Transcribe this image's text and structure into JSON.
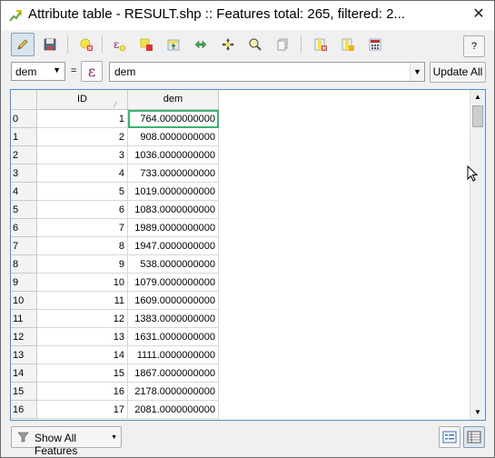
{
  "window": {
    "title": "Attribute table - RESULT.shp :: Features total: 265, filtered: 2...",
    "close_label": "✕"
  },
  "toolbar": {
    "help_label": "?"
  },
  "filter": {
    "field_value": "dem",
    "equals": "=",
    "expression_symbol": "ε",
    "expression_value": "dem",
    "update_label": "Update All"
  },
  "table": {
    "columns": [
      "ID",
      "dem"
    ],
    "rows": [
      {
        "row": "0",
        "id": "1",
        "dem": "764.0000000000"
      },
      {
        "row": "1",
        "id": "2",
        "dem": "908.0000000000"
      },
      {
        "row": "2",
        "id": "3",
        "dem": "1036.0000000000"
      },
      {
        "row": "3",
        "id": "4",
        "dem": "733.0000000000"
      },
      {
        "row": "4",
        "id": "5",
        "dem": "1019.0000000000"
      },
      {
        "row": "5",
        "id": "6",
        "dem": "1083.0000000000"
      },
      {
        "row": "6",
        "id": "7",
        "dem": "1989.0000000000"
      },
      {
        "row": "7",
        "id": "8",
        "dem": "1947.0000000000"
      },
      {
        "row": "8",
        "id": "9",
        "dem": "538.0000000000"
      },
      {
        "row": "9",
        "id": "10",
        "dem": "1079.0000000000"
      },
      {
        "row": "10",
        "id": "11",
        "dem": "1609.0000000000"
      },
      {
        "row": "11",
        "id": "12",
        "dem": "1383.0000000000"
      },
      {
        "row": "12",
        "id": "13",
        "dem": "1631.0000000000"
      },
      {
        "row": "13",
        "id": "14",
        "dem": "1111.0000000000"
      },
      {
        "row": "14",
        "id": "15",
        "dem": "1867.0000000000"
      },
      {
        "row": "15",
        "id": "16",
        "dem": "2178.0000000000"
      },
      {
        "row": "16",
        "id": "17",
        "dem": "2081.0000000000"
      }
    ]
  },
  "bottom": {
    "show_all_label": "Show All Features"
  },
  "colors": {
    "accent": "#4a90d9",
    "selected_cell": "#3cb371",
    "expression": "#8b1f6b"
  }
}
